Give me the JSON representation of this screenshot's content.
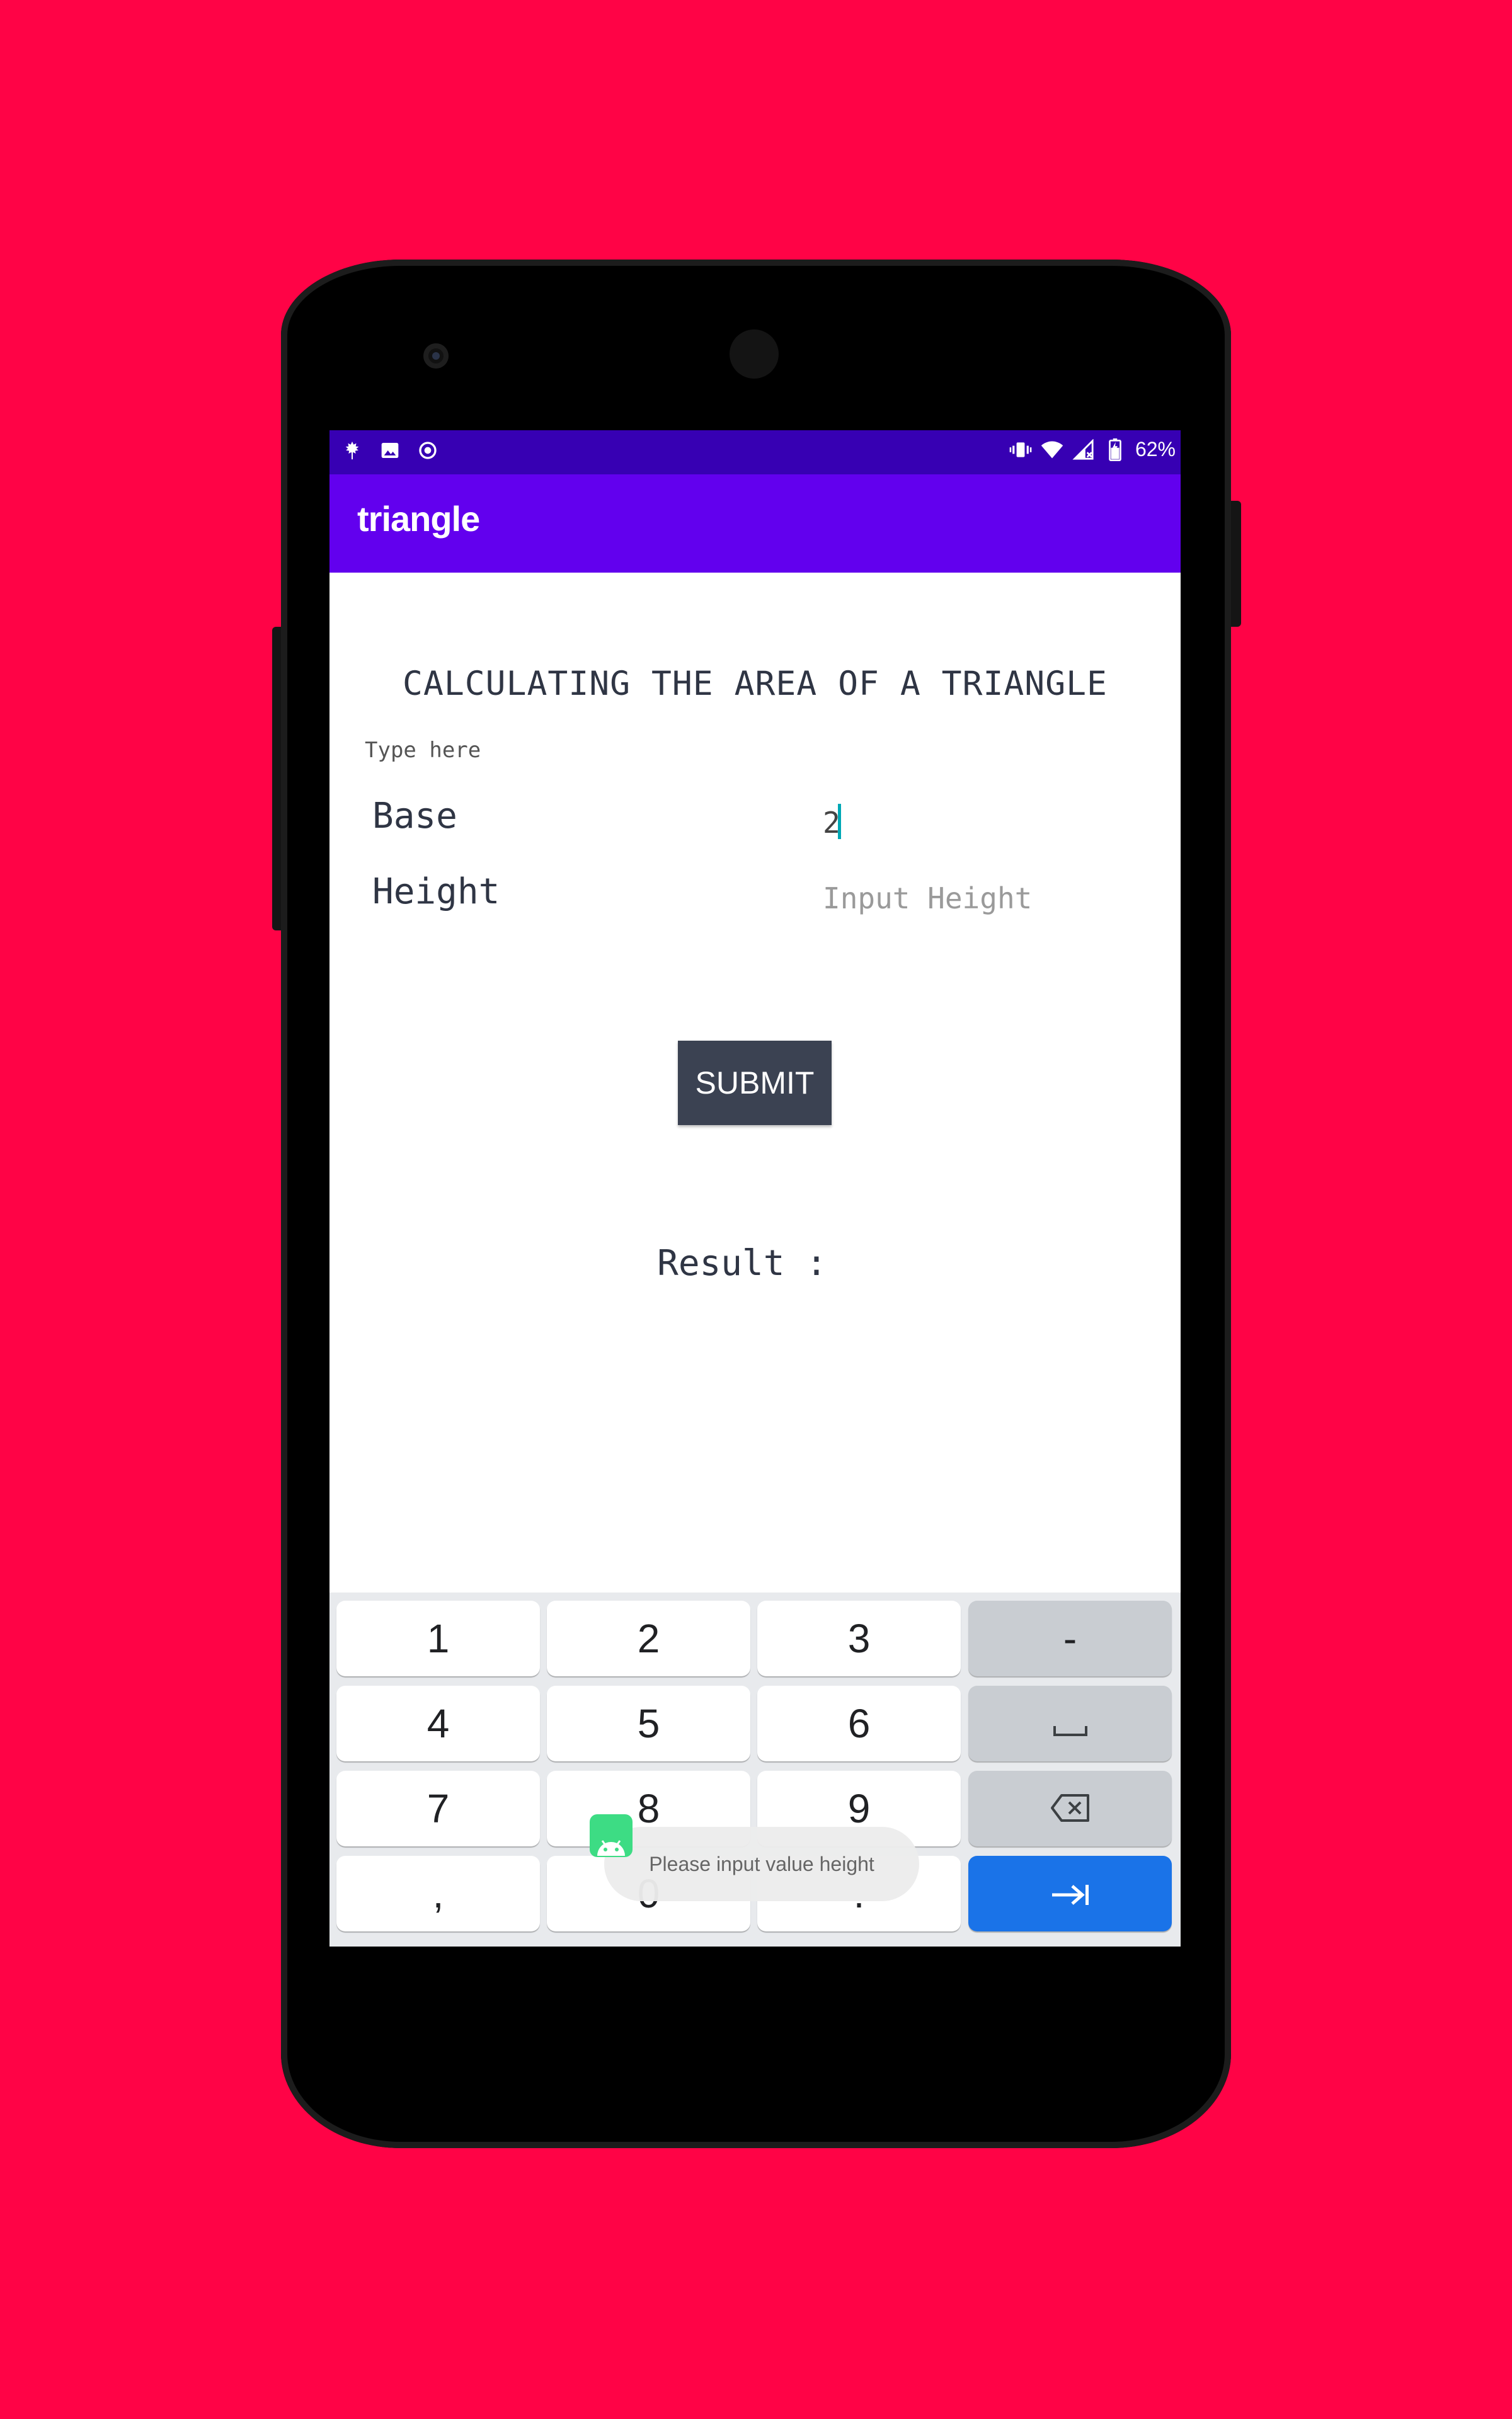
{
  "status_bar": {
    "left_icons": [
      "leaf-icon",
      "image-icon",
      "target-icon"
    ],
    "right_icons": [
      "vibrate-icon",
      "wifi-icon",
      "signal-icon",
      "battery-icon"
    ],
    "battery": "62%"
  },
  "app_bar": {
    "title": "triangle"
  },
  "main": {
    "heading": "CALCULATING THE AREA OF A TRIANGLE",
    "hint": "Type here",
    "base_label": "Base",
    "base_value": "2",
    "height_label": "Height",
    "height_placeholder": "Input Height",
    "submit_label": "SUBMIT",
    "result_label": "Result :"
  },
  "keyboard": {
    "rows": [
      [
        "1",
        "2",
        "3",
        "-"
      ],
      [
        "4",
        "5",
        "6",
        "␣"
      ],
      [
        "7",
        "8",
        "9",
        "⌫"
      ],
      [
        ",",
        "0",
        ".",
        "⇥"
      ]
    ]
  },
  "toast": {
    "message": "Please input value height"
  },
  "colors": {
    "background": "#FF0346",
    "status_bar": "#3700B3",
    "app_bar": "#6200EE",
    "submit": "#3B4252",
    "action_key": "#1A73E8"
  }
}
